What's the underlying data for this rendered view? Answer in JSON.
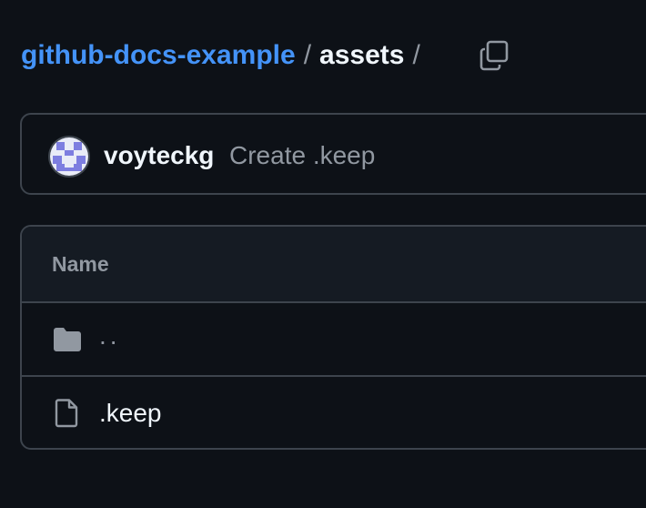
{
  "breadcrumb": {
    "repo": "github-docs-example",
    "separator": "/",
    "directory": "assets",
    "copy_icon": "copy-icon"
  },
  "commit": {
    "avatar_icon": "identicon-avatar",
    "author": "voyteckg",
    "message": "Create .keep"
  },
  "file_table": {
    "column_name": "Name",
    "rows": [
      {
        "icon": "folder-icon",
        "label": ".."
      },
      {
        "icon": "file-icon",
        "label": ".keep"
      }
    ]
  },
  "colors": {
    "background": "#0d1117",
    "link": "#4493f8",
    "border": "#3d444d",
    "muted": "#9198a1",
    "text": "#f0f6fc"
  }
}
